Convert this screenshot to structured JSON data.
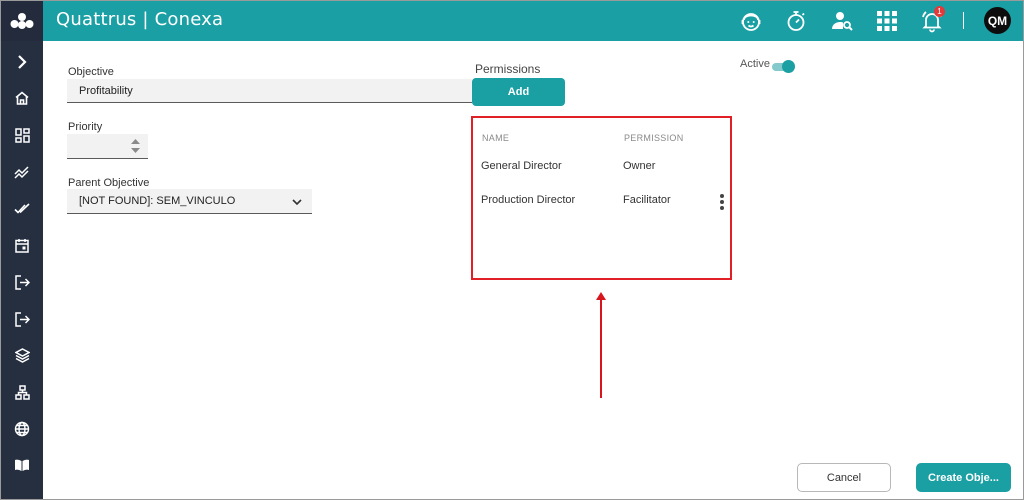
{
  "app": {
    "brand": "Quattrus | Conexa"
  },
  "header": {
    "icons": [
      "support-agent-icon",
      "stopwatch-icon",
      "user-search-icon",
      "apps-grid-icon",
      "bell-icon"
    ],
    "notification_count": "1",
    "avatar_initials": "QM"
  },
  "sidebar": {
    "items": [
      "expand-chevron-icon",
      "home-icon",
      "dashboard-icon",
      "trend-icon",
      "done-all-icon",
      "calendar-icon",
      "login-icon",
      "logout-icon",
      "layers-icon",
      "hierarchy-icon",
      "globe-icon",
      "book-icon"
    ]
  },
  "form": {
    "objective_label": "Objective",
    "objective_value": "Profitability",
    "priority_label": "Priority",
    "priority_value": "",
    "parent_label": "Parent Objective",
    "parent_value": "[NOT FOUND]: SEM_VINCULO"
  },
  "permissions": {
    "title": "Permissions",
    "add_label": "Add",
    "columns": [
      "NAME",
      "PERMISSION"
    ],
    "rows": [
      {
        "name": "General Director",
        "permission": "Owner"
      },
      {
        "name": "Production Director",
        "permission": "Facilitator"
      }
    ]
  },
  "status": {
    "active_label": "Active",
    "active": true
  },
  "footer": {
    "cancel_label": "Cancel",
    "create_label": "Create Obje..."
  },
  "colors": {
    "header": "#1aa0a4",
    "sidebar": "#262f40",
    "accent": "#1a9fa3",
    "highlight": "#e01f26"
  }
}
